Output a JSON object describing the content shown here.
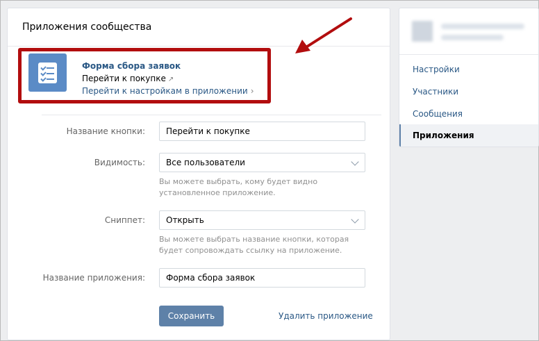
{
  "header": {
    "title": "Приложения сообщества"
  },
  "app": {
    "name": "Форма сбора заявок",
    "link_label": "Перейти к покупке",
    "link_arrow": "↗",
    "settings_link": "Перейти к настройкам в приложении",
    "settings_chevron": "›",
    "icon": "checklist-icon"
  },
  "form": {
    "button_name": {
      "label": "Название кнопки:",
      "value": "Перейти к покупке"
    },
    "visibility": {
      "label": "Видимость:",
      "value": "Все пользователи",
      "hint_line1": "Вы можете выбрать, кому будет видно",
      "hint_line2": "установленное приложение."
    },
    "snippet": {
      "label": "Сниппет:",
      "value": "Открыть",
      "hint_line1": "Вы можете выбрать название кнопки, которая",
      "hint_line2": "будет сопровождать ссылку на приложение."
    },
    "app_name": {
      "label": "Название приложения:",
      "value": "Форма сбора заявок"
    },
    "save_label": "Сохранить",
    "delete_label": "Удалить приложение"
  },
  "sidebar": {
    "items": [
      {
        "label": "Настройки"
      },
      {
        "label": "Участники"
      },
      {
        "label": "Сообщения"
      },
      {
        "label": "Приложения",
        "active": true
      }
    ]
  },
  "colors": {
    "accent": "#2a5885",
    "button": "#5e81a8",
    "highlight_box": "#b20d0e",
    "icon_bg": "#5b8bc6"
  }
}
